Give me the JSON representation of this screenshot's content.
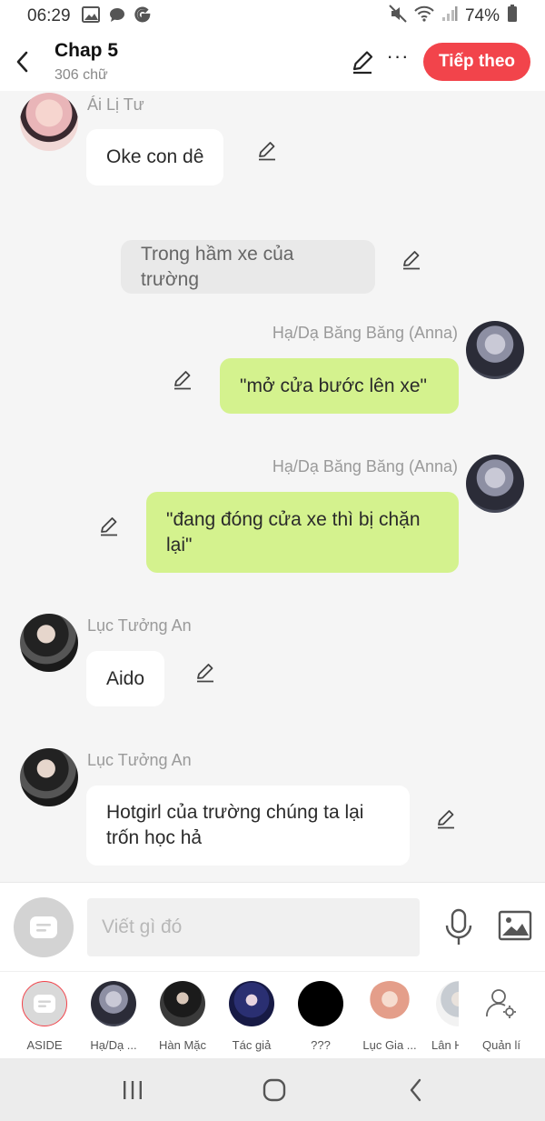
{
  "status_bar": {
    "time": "06:29",
    "battery": "74%",
    "left_icons": [
      "image-icon",
      "chat-bubble-icon",
      "google-icon"
    ],
    "right_icons": [
      "mute-icon",
      "wifi-icon",
      "signal-icon",
      "battery-icon"
    ]
  },
  "header": {
    "title": "Chap 5",
    "subtitle": "306 chữ",
    "next_label": "Tiếp theo",
    "more_label": "···",
    "accent_color": "#f2444b"
  },
  "messages": [
    {
      "sender": "Ái Lị Tư",
      "text": "Oke con dê",
      "side": "left",
      "style": "white"
    },
    {
      "sender": "",
      "text": "Trong hầm xe của trường",
      "side": "center",
      "style": "gray"
    },
    {
      "sender": "Hạ/Dạ Băng Băng (Anna)",
      "text": "\"mở cửa bước lên xe\"",
      "side": "right",
      "style": "green"
    },
    {
      "sender": "Hạ/Dạ Băng Băng (Anna)",
      "text": "\"đang đóng cửa xe thì bị chặn lại\"",
      "side": "right",
      "style": "green"
    },
    {
      "sender": "Lục Tưởng An",
      "text": "Aido",
      "side": "left",
      "style": "white"
    },
    {
      "sender": "Lục Tưởng An",
      "text": "Hotgirl của trường chúng ta lại trốn học hả",
      "side": "left",
      "style": "white"
    }
  ],
  "input": {
    "placeholder": "Viết gì đó"
  },
  "characters": [
    {
      "label": "ASIDE",
      "icon": "aside-icon"
    },
    {
      "label": "Hạ/Dạ ...",
      "icon": "avatar"
    },
    {
      "label": "Hàn Mặc",
      "icon": "avatar"
    },
    {
      "label": "Tác giả",
      "icon": "avatar"
    },
    {
      "label": "???",
      "icon": "avatar"
    },
    {
      "label": "Lục Gia ...",
      "icon": "avatar"
    },
    {
      "label": "Lân H",
      "icon": "avatar"
    },
    {
      "label": "Quản lí",
      "icon": "user-settings-icon"
    }
  ],
  "nav": [
    "recent-apps-icon",
    "home-icon",
    "back-icon"
  ]
}
